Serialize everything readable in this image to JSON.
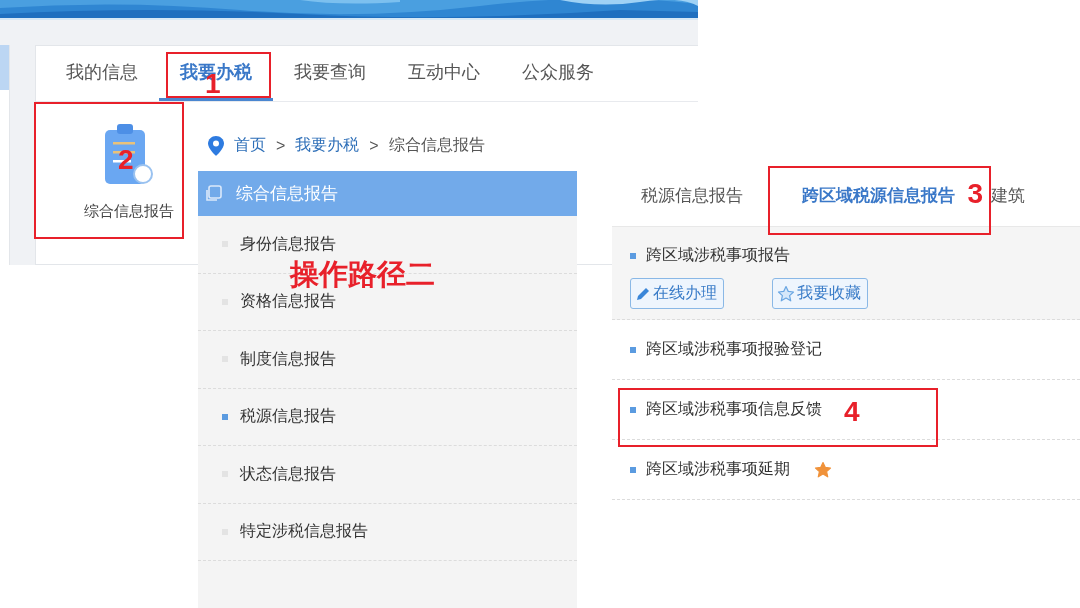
{
  "top_tabs": [
    {
      "label": "我的信息",
      "selected": false
    },
    {
      "label": "我要办税",
      "selected": true,
      "step": "1"
    },
    {
      "label": "我要查询",
      "selected": false
    },
    {
      "label": "互动中心",
      "selected": false
    },
    {
      "label": "公众服务",
      "selected": false
    }
  ],
  "service_tile": {
    "label": "综合信息报告",
    "step": "2"
  },
  "breadcrumb": [
    {
      "kind": "link",
      "text": "首页"
    },
    {
      "kind": "separator",
      "text": ">"
    },
    {
      "kind": "link",
      "text": "我要办税"
    },
    {
      "kind": "separator",
      "text": ">"
    },
    {
      "kind": "current",
      "text": "综合信息报告"
    }
  ],
  "side_menu": {
    "title": "综合信息报告",
    "items": [
      {
        "label": "身份信息报告",
        "selected": false
      },
      {
        "label": "资格信息报告",
        "selected": false
      },
      {
        "label": "制度信息报告",
        "selected": false
      },
      {
        "label": "税源信息报告",
        "selected": true
      },
      {
        "label": "状态信息报告",
        "selected": false
      },
      {
        "label": "特定涉税信息报告",
        "selected": false
      }
    ]
  },
  "caption": "操作路径二",
  "sub_tabs": [
    {
      "label": "税源信息报告",
      "selected": false
    },
    {
      "label": "跨区域税源信息报告",
      "selected": true,
      "step": "3"
    },
    {
      "label": "建筑",
      "selected": false
    }
  ],
  "matters": [
    {
      "label": "跨区域涉税事项报告",
      "expanded": true,
      "starred": false,
      "actions": [
        {
          "kind": "edit",
          "label": "在线办理"
        },
        {
          "kind": "favorite",
          "label": "我要收藏"
        }
      ]
    },
    {
      "label": "跨区域涉税事项报验登记",
      "expanded": false,
      "starred": false
    },
    {
      "label": "跨区域涉税事项信息反馈",
      "expanded": false,
      "starred": false,
      "step": "4"
    },
    {
      "label": "跨区域涉税事项延期",
      "expanded": false,
      "starred": true
    }
  ]
}
